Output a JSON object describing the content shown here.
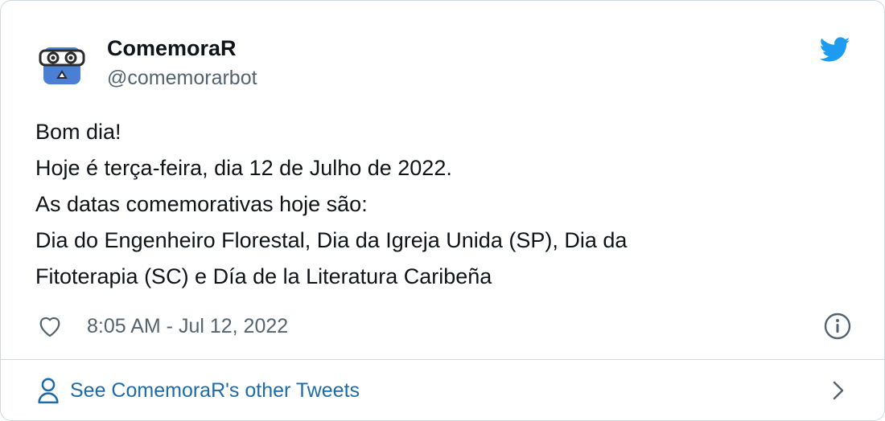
{
  "author": {
    "name": "ComemoraR",
    "handle": "@comemorarbot",
    "avatar_icon": "robot-avatar-icon"
  },
  "brand": {
    "logo_icon": "twitter-bird-icon",
    "color": "#1d9bf0"
  },
  "tweet": {
    "lines": [
      "Bom dia!",
      "Hoje é terça-feira, dia 12 de Julho de 2022.",
      "As datas comemorativas hoje são:",
      "Dia do Engenheiro Florestal, Dia da Igreja Unida (SP), Dia da",
      "Fitoterapia (SC) e Día de la Literatura Caribeña"
    ],
    "timestamp": "8:05 AM - Jul 12, 2022"
  },
  "actions": {
    "like_icon": "heart-icon",
    "info_icon": "info-icon"
  },
  "footer": {
    "link_label": "See ComemoraR's other Tweets",
    "link_icon": "person-icon",
    "arrow_icon": "chevron-right-icon",
    "link_color": "#1d6ba8"
  }
}
